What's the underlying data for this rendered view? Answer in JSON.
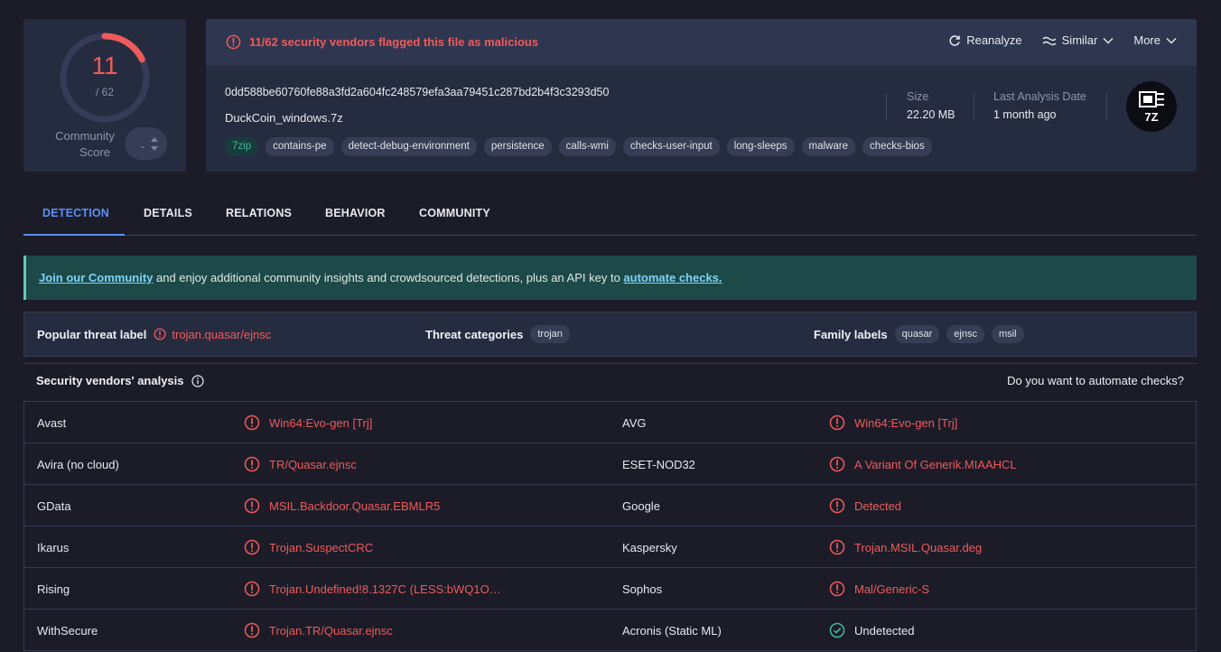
{
  "score": {
    "detections": "11",
    "total": "/ 62",
    "community_label_1": "Community",
    "community_label_2": "Score",
    "community_value": "-",
    "fraction": 0.177
  },
  "alert": {
    "text": "11/62 security vendors flagged this file as malicious"
  },
  "actions": {
    "reanalyze": "Reanalyze",
    "similar": "Similar",
    "more": "More"
  },
  "file": {
    "hash": "0dd588be60760fe88a3fd2a604fc248579efa3aa79451c287bd2b4f3c3293d50",
    "name": "DuckCoin_windows.7z",
    "tags": [
      "7zip",
      "contains-pe",
      "detect-debug-environment",
      "persistence",
      "calls-wmi",
      "checks-user-input",
      "long-sleeps",
      "malware",
      "checks-bios"
    ],
    "size_label": "Size",
    "size": "22.20 MB",
    "last_analysis_label": "Last Analysis Date",
    "last_analysis": "1 month ago",
    "type_badge": "7Z"
  },
  "tabs": [
    "DETECTION",
    "DETAILS",
    "RELATIONS",
    "BEHAVIOR",
    "COMMUNITY"
  ],
  "banner": {
    "link1": "Join our Community",
    "mid": " and enjoy additional community insights and crowdsourced detections, plus an API key to ",
    "link2": "automate checks."
  },
  "threat": {
    "popular_label": "Popular threat label",
    "popular_value": "trojan.quasar/ejnsc",
    "categories_label": "Threat categories",
    "categories": [
      "trojan"
    ],
    "family_label": "Family labels",
    "families": [
      "quasar",
      "ejnsc",
      "msil"
    ]
  },
  "vendors_header": {
    "title": "Security vendors' analysis",
    "right": "Do you want to automate checks?"
  },
  "vendors": [
    [
      {
        "name": "Avast",
        "result": "Win64:Evo-gen [Trj]",
        "status": "malicious"
      },
      {
        "name": "AVG",
        "result": "Win64:Evo-gen [Trj]",
        "status": "malicious"
      }
    ],
    [
      {
        "name": "Avira (no cloud)",
        "result": "TR/Quasar.ejnsc",
        "status": "malicious"
      },
      {
        "name": "ESET-NOD32",
        "result": "A Variant Of Generik.MIAAHCL",
        "status": "malicious"
      }
    ],
    [
      {
        "name": "GData",
        "result": "MSIL.Backdoor.Quasar.EBMLR5",
        "status": "malicious"
      },
      {
        "name": "Google",
        "result": "Detected",
        "status": "malicious"
      }
    ],
    [
      {
        "name": "Ikarus",
        "result": "Trojan.SuspectCRC",
        "status": "malicious"
      },
      {
        "name": "Kaspersky",
        "result": "Trojan.MSIL.Quasar.deg",
        "status": "malicious"
      }
    ],
    [
      {
        "name": "Rising",
        "result": "Trojan.Undefined!8.1327C (LESS:bWQ1O…",
        "status": "malicious"
      },
      {
        "name": "Sophos",
        "result": "Mal/Generic-S",
        "status": "malicious"
      }
    ],
    [
      {
        "name": "WithSecure",
        "result": "Trojan.TR/Quasar.ejnsc",
        "status": "malicious"
      },
      {
        "name": "Acronis (Static ML)",
        "result": "Undetected",
        "status": "undetected"
      }
    ]
  ],
  "colors": {
    "danger": "#ef5a5a",
    "accent": "#5d8ff5",
    "clean": "#41b79a"
  }
}
